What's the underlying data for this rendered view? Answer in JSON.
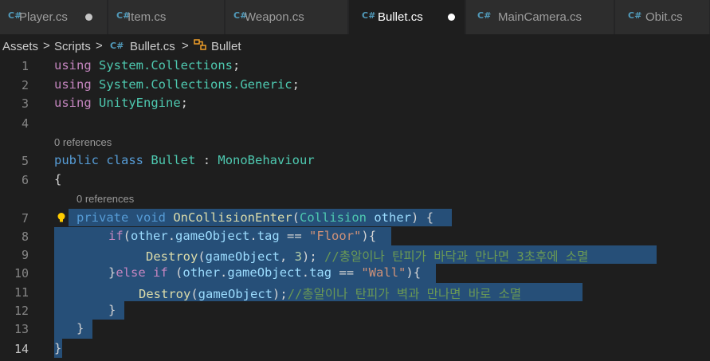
{
  "tabs": [
    {
      "label": "Player.cs",
      "icon": "C#",
      "dirty": true,
      "active": false
    },
    {
      "label": "Item.cs",
      "icon": "C#",
      "dirty": false,
      "active": false
    },
    {
      "label": "Weapon.cs",
      "icon": "C#",
      "dirty": false,
      "active": false
    },
    {
      "label": "Bullet.cs",
      "icon": "C#",
      "dirty": true,
      "active": true
    },
    {
      "label": "MainCamera.cs",
      "icon": "C#",
      "dirty": false,
      "active": false
    },
    {
      "label": "Obit.cs",
      "icon": "C#",
      "dirty": false,
      "active": false
    }
  ],
  "breadcrumb": {
    "assets": "Assets",
    "scripts": "Scripts",
    "file_icon": "C#",
    "file": "Bullet.cs",
    "class": "Bullet",
    "sep": ">"
  },
  "editor": {
    "codelens": "0 references",
    "line_numbers": [
      "1",
      "2",
      "3",
      "4",
      "5",
      "6",
      "7",
      "8",
      "9",
      "10",
      "11",
      "12",
      "13",
      "14"
    ],
    "code": {
      "using": "using",
      "ns1": "System.Collections",
      "ns2": "System.Collections.Generic",
      "ns3": "UnityEngine",
      "semi": ";",
      "public": "public",
      "class_kw": "class",
      "class_name": "Bullet",
      "colon": " : ",
      "base": "MonoBehaviour",
      "open_brace": "{",
      "close_brace": "}",
      "private": "private",
      "void": "void",
      "method": "OnCollisionEnter",
      "param_type": "Collision",
      "param": "other",
      "if": "if",
      "else": "else",
      "other": "other",
      "gameObject": "gameObject",
      "tag": "tag",
      "eq": " == ",
      "floor": "\"Floor\"",
      "wall": "\"Wall\"",
      "destroy": "Destroy",
      "three": "3",
      "comment1": "//총알이나 탄피가 바닥과 만나면 3초후에 소멸",
      "comment2": "//총알이나 탄피가 벽과 만나면 바로 소멸"
    }
  }
}
